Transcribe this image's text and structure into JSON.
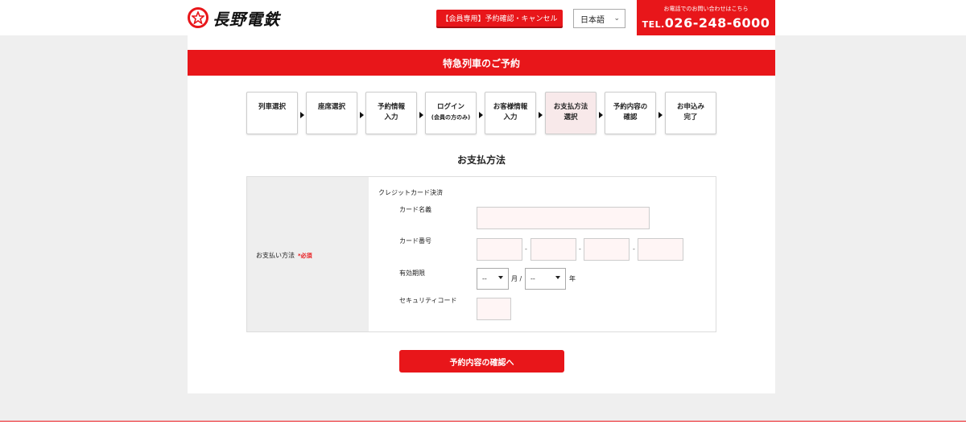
{
  "header": {
    "logo_text": "長野電鉄",
    "member_button": "【会員専用】予約確認・キャンセル",
    "language": "日本語",
    "tel_note": "お電話でのお問い合わせはこちら",
    "tel_prefix": "TEL.",
    "tel_number": "026-248-6000"
  },
  "page": {
    "title": "特急列車のご予約",
    "section_title": "お支払方法"
  },
  "steps": [
    {
      "line1": "列車選択",
      "line2": "",
      "line3": "",
      "active": false
    },
    {
      "line1": "座席選択",
      "line2": "",
      "line3": "",
      "active": false
    },
    {
      "line1": "予約情報",
      "line2": "入力",
      "line3": "",
      "active": false
    },
    {
      "line1": "ログイン",
      "line2": "(会員の方のみ)",
      "line3": "",
      "active": false
    },
    {
      "line1": "お客様情報",
      "line2": "入力",
      "line3": "",
      "active": false
    },
    {
      "line1": "お支払方法",
      "line2": "選択",
      "line3": "",
      "active": true
    },
    {
      "line1": "予約内容の",
      "line2": "確認",
      "line3": "",
      "active": false
    },
    {
      "line1": "お申込み",
      "line2": "完了",
      "line3": "",
      "active": false
    }
  ],
  "payment": {
    "label": "お支払い方法",
    "required": "*必須",
    "method": "クレジットカード決済",
    "card_name_label": "カード名義",
    "card_number_label": "カード番号",
    "expiry_label": "有効期限",
    "month_value": "--",
    "month_unit": "月 /",
    "year_value": "--",
    "year_unit": "年",
    "security_label": "セキュリティコード",
    "dash": "-"
  },
  "actions": {
    "confirm_button": "予約内容の確認へ"
  },
  "colors": {
    "brand_red": "#e8161a",
    "active_step_bg": "#f8e9ea",
    "input_bg": "#fff5f5"
  }
}
